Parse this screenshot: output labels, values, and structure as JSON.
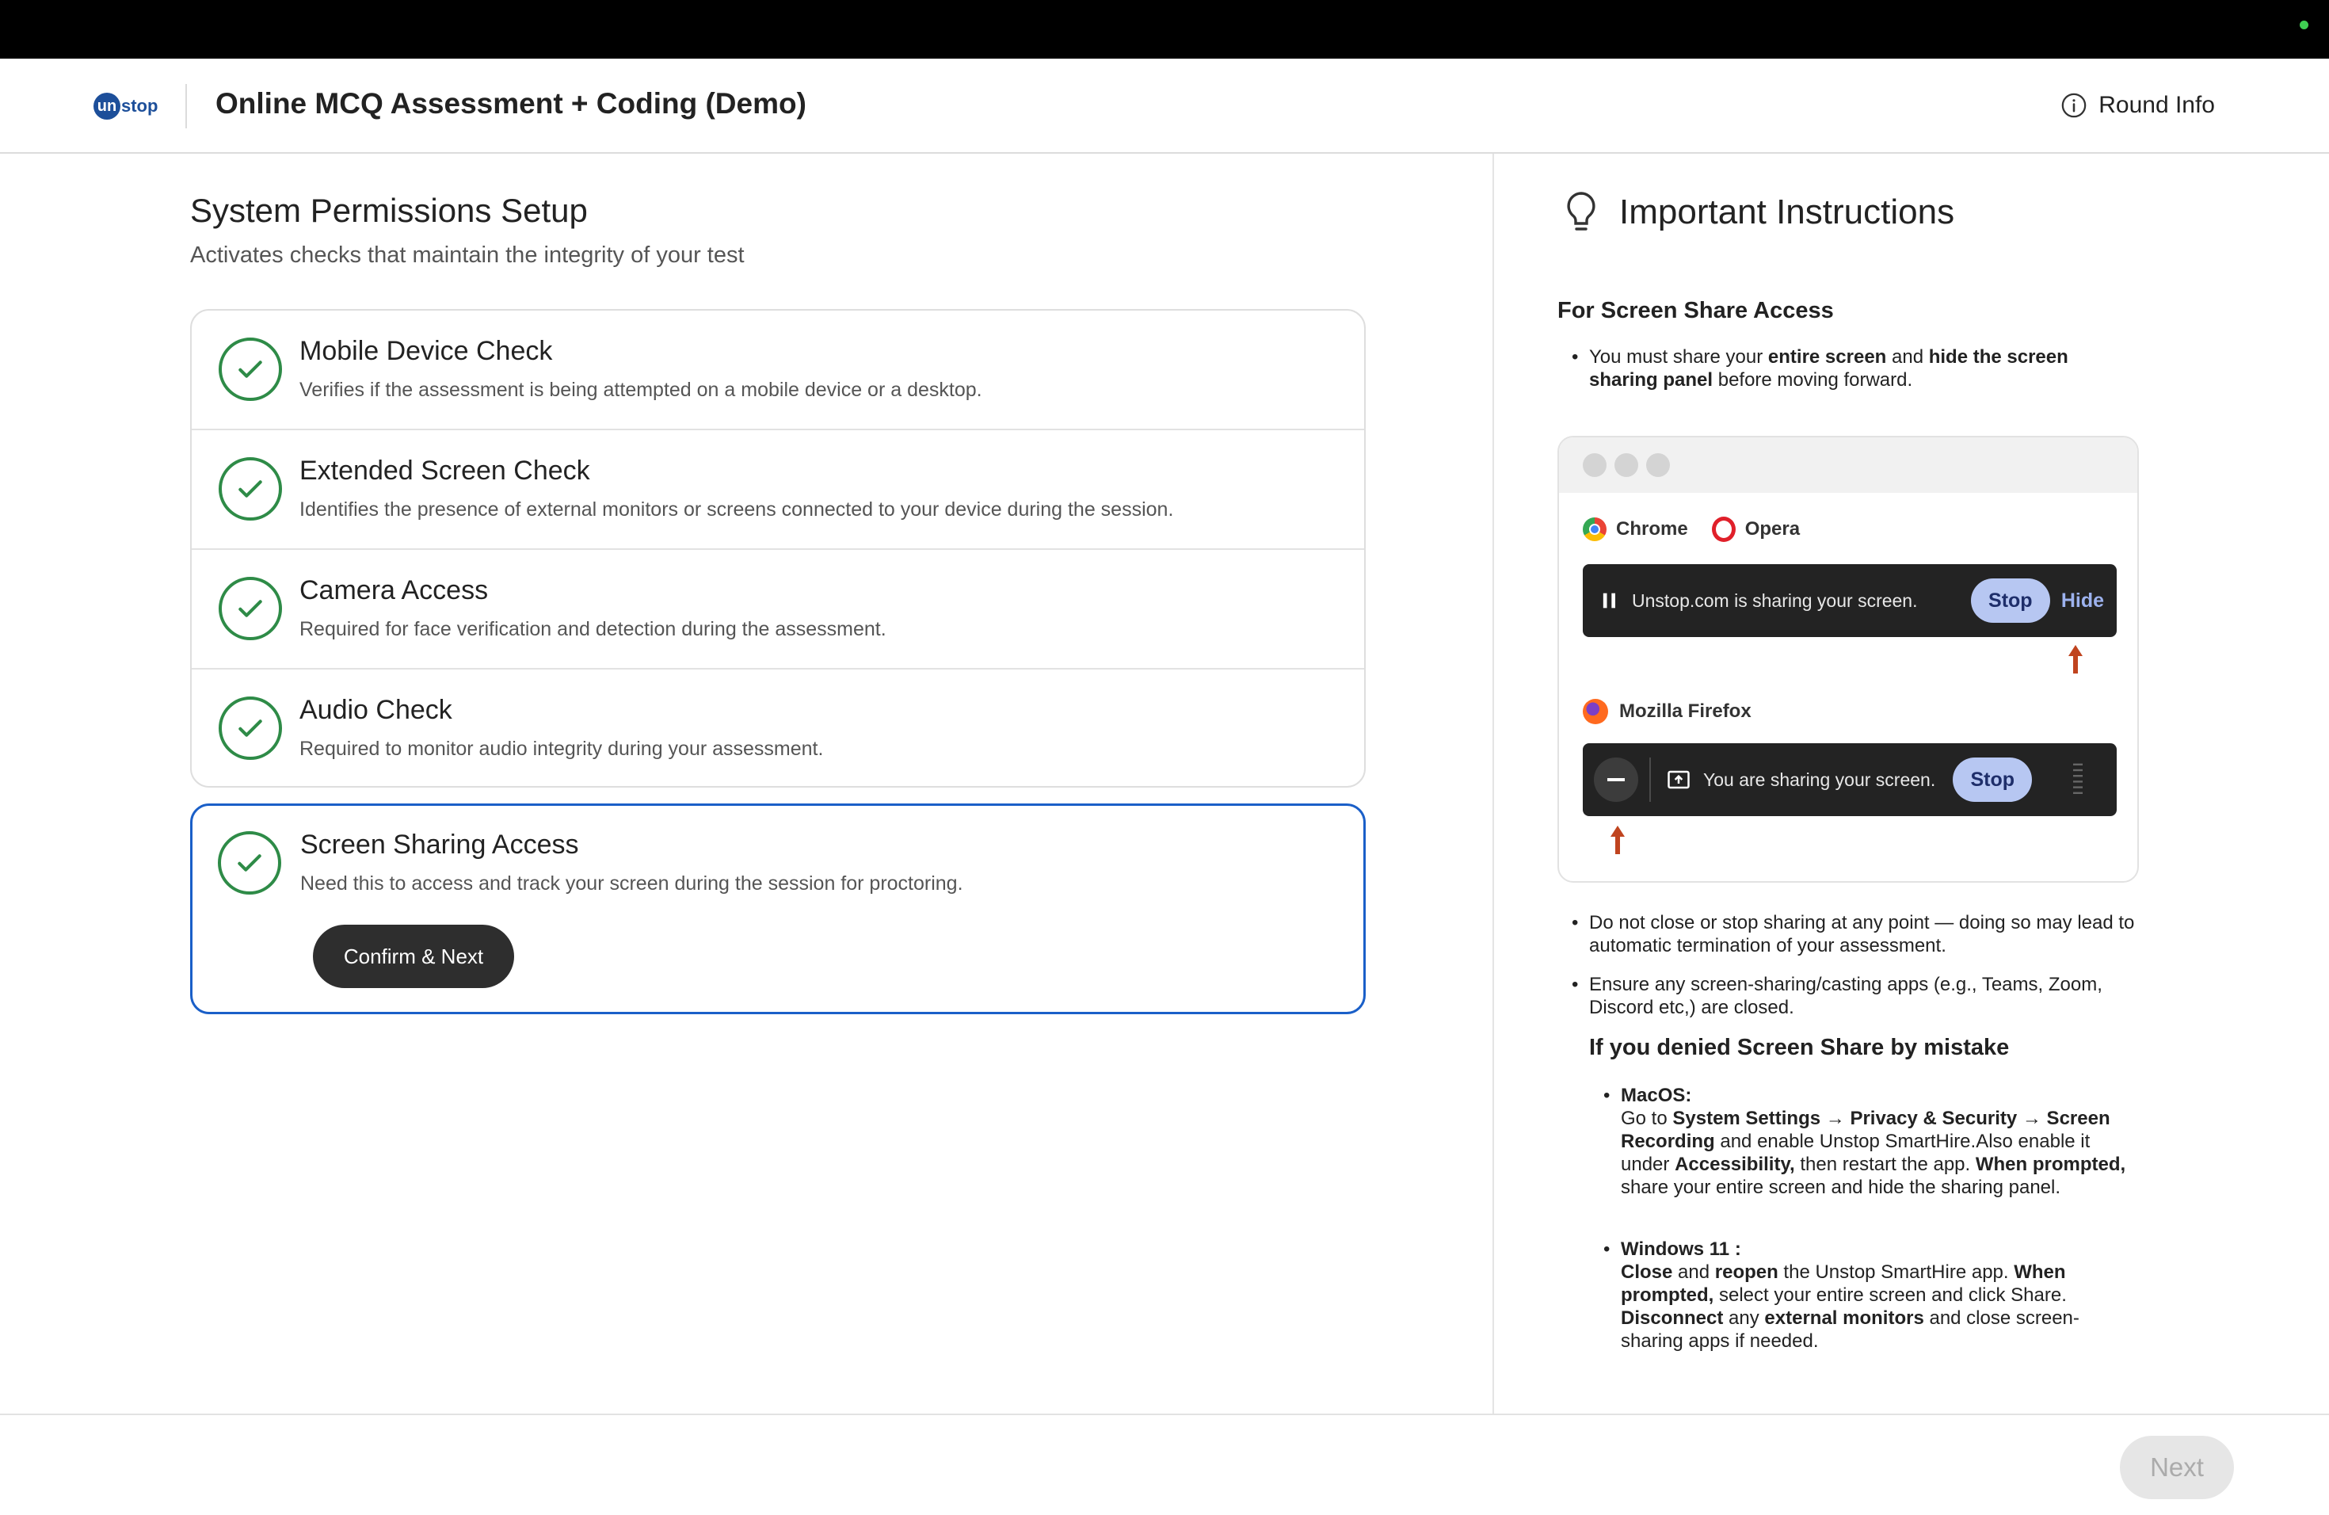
{
  "header": {
    "logo_prefix": "un",
    "logo_suffix": "stop",
    "title": "Online MCQ Assessment + Coding (Demo)",
    "round_info": "Round Info"
  },
  "setup": {
    "title": "System Permissions Setup",
    "subtitle": "Activates checks that maintain the integrity of your test",
    "checks": [
      {
        "title": "Mobile Device Check",
        "desc": "Verifies if the assessment is being attempted on a mobile device or a desktop.",
        "status": "passed"
      },
      {
        "title": "Extended Screen Check",
        "desc": "Identifies the presence of external monitors or screens connected to your device during the session.",
        "status": "passed"
      },
      {
        "title": "Camera Access",
        "desc": "Required for face verification and detection during the assessment.",
        "status": "passed"
      },
      {
        "title": "Audio Check",
        "desc": "Required to monitor audio integrity during your assessment.",
        "status": "passed"
      }
    ],
    "screen_share": {
      "title": "Screen Sharing Access",
      "desc": "Need this to access and track your screen during the session for proctoring.",
      "button": "Confirm & Next",
      "status": "passed"
    }
  },
  "instructions": {
    "heading": "Important Instructions",
    "for_screen_share": "For Screen Share Access",
    "bullet1": {
      "p1": "You must share your ",
      "b1": "entire screen",
      "p2": " and ",
      "b2": "hide the screen sharing panel",
      "p3": " before moving forward."
    },
    "demo": {
      "chrome": "Chrome",
      "opera": "Opera",
      "chrome_bar_text": "Unstop.com is sharing your screen.",
      "stop": "Stop",
      "hide": "Hide",
      "firefox": "Mozilla Firefox",
      "firefox_bar_text": "You are sharing your screen."
    },
    "bullet2": "Do not close or stop sharing at any point — doing so may lead to automatic termination of your assessment.",
    "bullet3": "Ensure any screen-sharing/casting apps (e.g., Teams, Zoom, Discord etc,) are closed.",
    "denied_heading": "If you denied Screen Share by mistake",
    "macos": {
      "label": "MacOS:",
      "p1": "Go to ",
      "b1": "System Settings → Privacy & Security → Screen Recording",
      "p2": " and enable Unstop SmartHire.Also enable it under ",
      "b2": "Accessibility,",
      "p3": " then restart the app. ",
      "b3": "When prompted,",
      "p4": " share your entire screen and hide the sharing panel."
    },
    "windows": {
      "label": "Windows 11 :",
      "b1": "Close",
      "p1": " and ",
      "b2": "reopen",
      "p2": " the Unstop SmartHire app. ",
      "b3": "When prompted,",
      "p3": " select your entire screen and click Share. ",
      "b4": "Disconnect",
      "p4": " any ",
      "b5": "external monitors",
      "p5": " and close screen-sharing apps if needed."
    }
  },
  "footer": {
    "next": "Next"
  },
  "colors": {
    "check_green": "#2e8b47",
    "active_border": "#1a5fc8",
    "brand_blue": "#1d4f9a",
    "arrow": "#c0441f"
  }
}
